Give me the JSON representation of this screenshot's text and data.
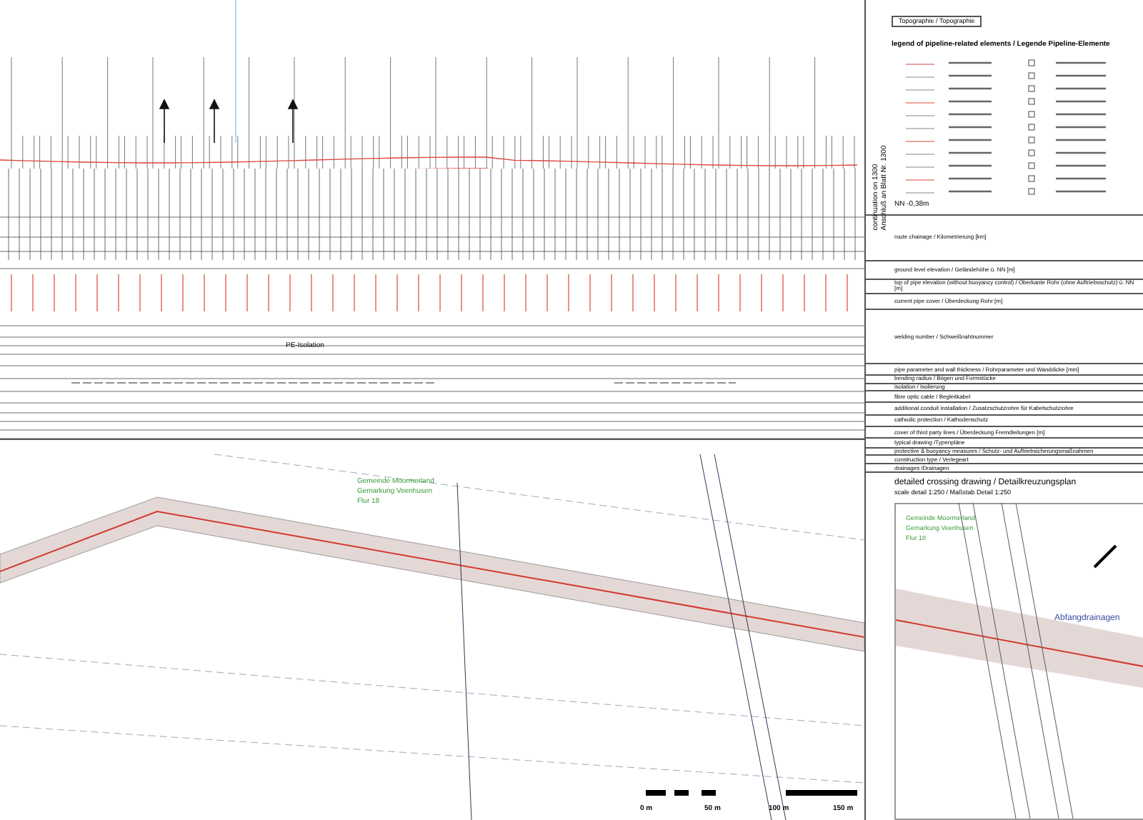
{
  "tab": {
    "label": "Topographie / Topographie"
  },
  "continuation": {
    "line_1": "continuation on 1300",
    "line_2": "Anschluß an Blatt Nr. 1300"
  },
  "legend": {
    "title": "legend of pipeline-related elements / Legende Pipeline-Elemente"
  },
  "profile": {
    "datum": "NN -0,38m",
    "isolation": "PE-Isolation"
  },
  "rows": [
    "route chainage / Kilometrierung [km]",
    "ground level elevation / Geländehöhe ü. NN [m]",
    "top of pipe elevation (without buoyancy control) / Oberkante Rohr (ohne Auftriebsschutz) ü. NN [m]",
    "current pipe cover / Überdeckung Rohr [m]",
    "welding number / Schweißnahtnummer",
    "pipe parameter and wall thickness / Rohrparameter und Wanddicke [mm]",
    "bending radius / Bögen und Formstücke",
    "isolation / Isolierung",
    "fibre optic cable / Begleitkabel",
    "additional conduit installation / Zusatzschutzrohre für Kabelschutzrohre",
    "cathodic protection / Kathodenschutz",
    "cover of third party lines / Überdeckung Fremdleitungen [m]",
    "typical drawing /Typenpläne",
    "protective & buoyancy measures / Schutz- und Auftriebsicherungsmaßnahmen",
    "construction type / Verlegeart",
    "drainages /Drainagen"
  ],
  "plan": {
    "labels": [
      "Gemeinde Moormerland",
      "Gemarkung Veenhusen",
      "Flur 18"
    ],
    "scale": [
      "0 m",
      "50 m",
      "100 m",
      "150 m"
    ]
  },
  "detail": {
    "title": "detailed crossing drawing / Detailkreuzungsplan",
    "scale": "scale detail 1:250 / Maßstab Detail 1:250",
    "labels": [
      "Gemeinde Moormerland",
      "Gemarkung Veenhusen",
      "Flur 18"
    ],
    "callout": "Abfangdrainagen"
  }
}
